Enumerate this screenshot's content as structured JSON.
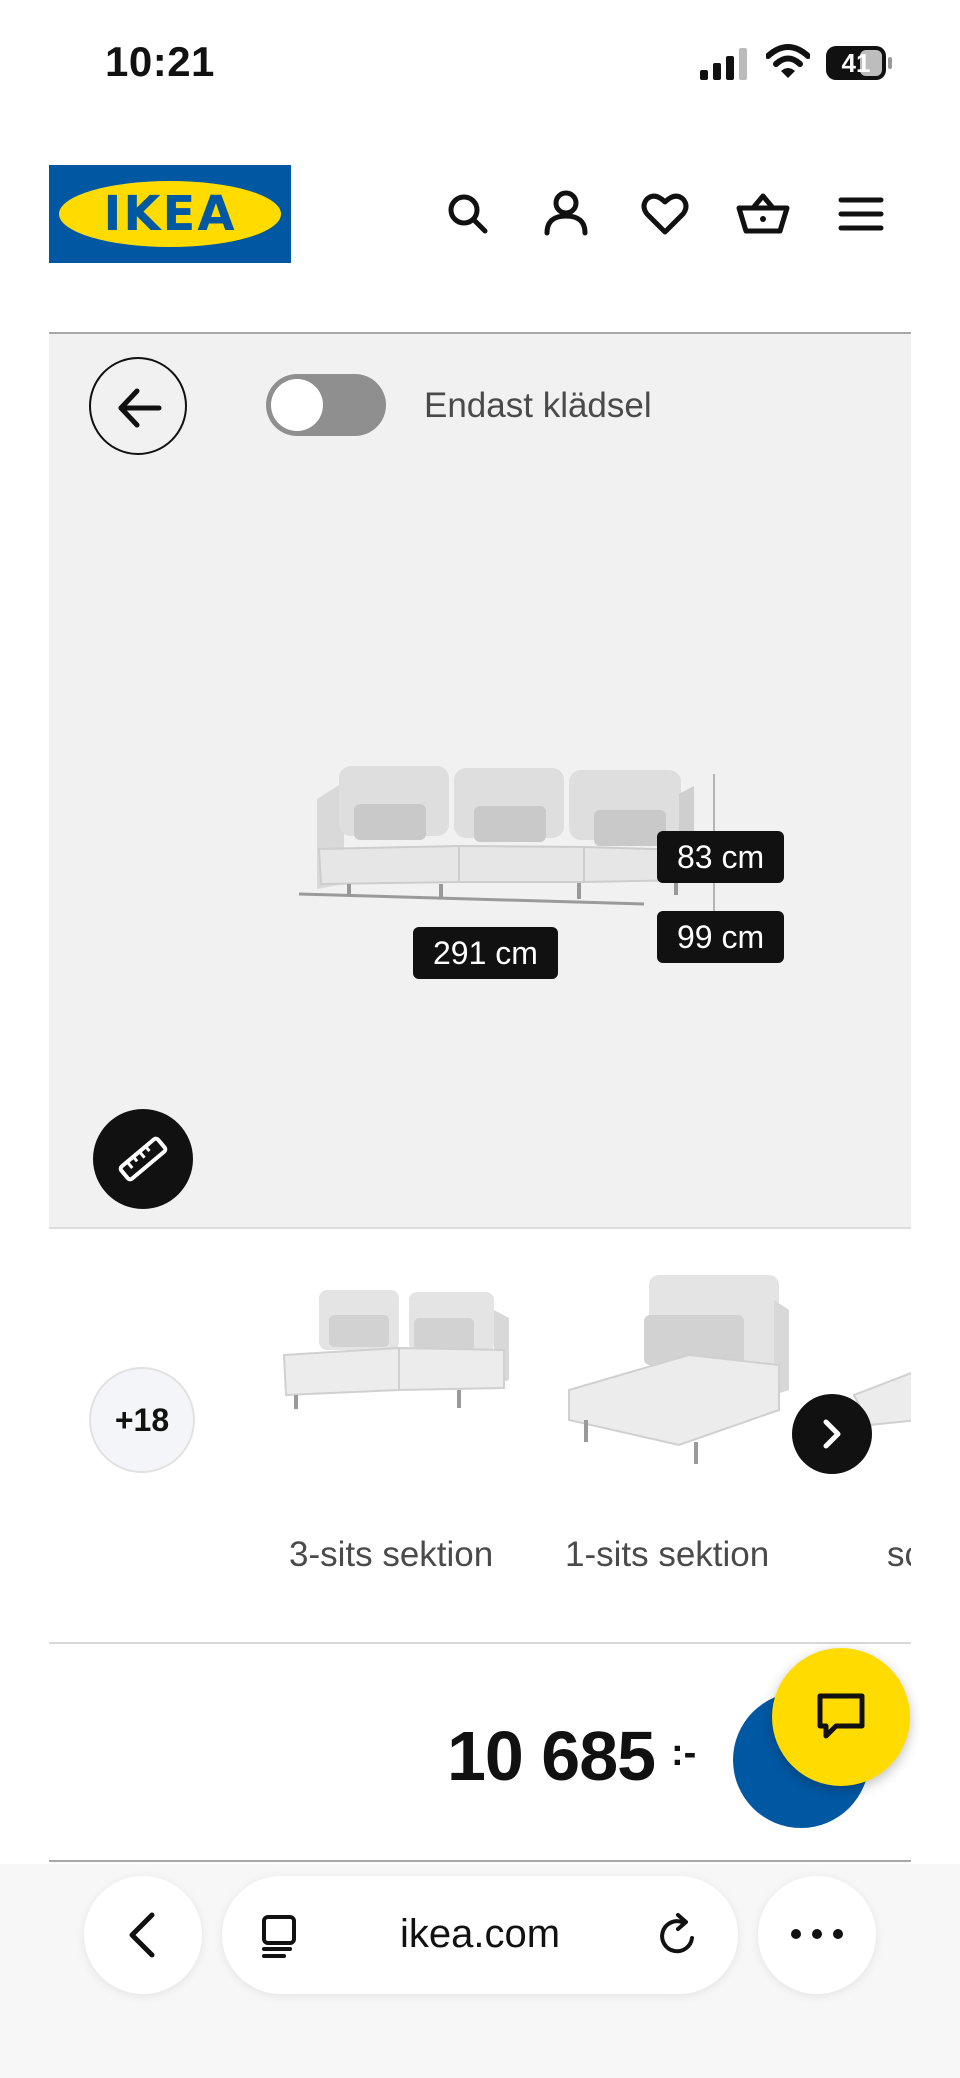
{
  "status_bar": {
    "time": "10:21",
    "battery": "41",
    "icons": [
      "signal-icon",
      "wifi-icon",
      "battery-icon"
    ]
  },
  "header": {
    "logo_text": "IKEA",
    "icons": [
      "search-icon",
      "account-icon",
      "heart-icon",
      "basket-icon",
      "menu-icon"
    ],
    "colors": {
      "brand_blue": "#0058a3",
      "brand_yellow": "#ffdb00"
    }
  },
  "viewer": {
    "toggle_label": "Endast klädsel",
    "toggle_on": false,
    "dimensions": {
      "width": "291 cm",
      "height": "83 cm",
      "depth": "99 cm"
    }
  },
  "variants": {
    "more_label": "+18",
    "items": [
      {
        "label": "3-sits sektion"
      },
      {
        "label": "1-sits sektion"
      },
      {
        "label": "sc"
      }
    ]
  },
  "price": {
    "value": "10 685",
    "currency": ":-"
  },
  "browser": {
    "url": "ikea.com",
    "icons": [
      "back-icon",
      "tabs-icon",
      "reload-icon",
      "more-icon"
    ]
  }
}
